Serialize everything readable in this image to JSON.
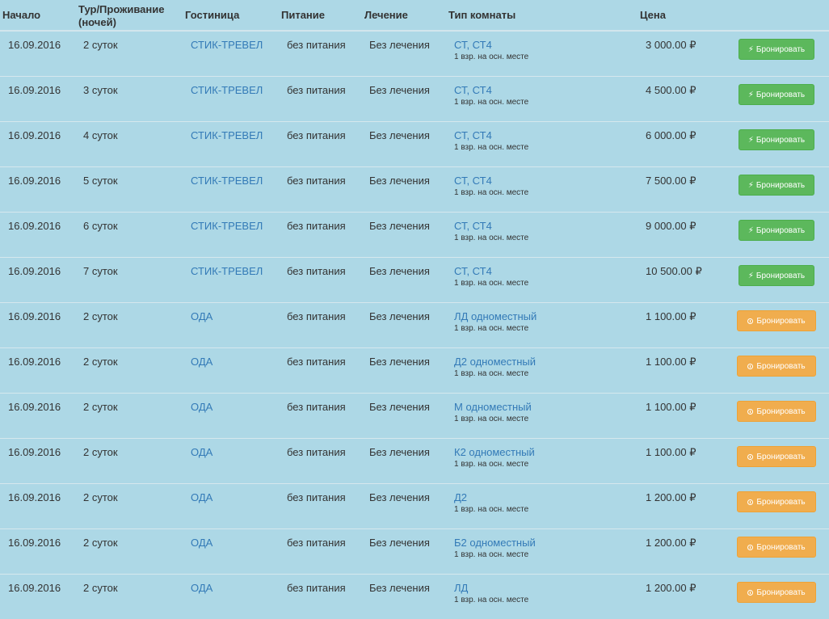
{
  "header": {
    "start": "Начало",
    "nights": "Тур/Проживание (ночей)",
    "hotel": "Гостиница",
    "meal": "Питание",
    "treatment": "Лечение",
    "room": "Тип комнаты",
    "price": "Цена"
  },
  "rows": [
    {
      "start": "16.09.2016",
      "nights": "2 суток",
      "hotel": "СТИК-ТРЕВЕЛ",
      "meal": "без питания",
      "treatment": "Без лечения",
      "room": "СТ, СТ4",
      "placement": "1 взр. на осн. месте",
      "price": "3 000.00 ₽",
      "button": "Бронировать",
      "status": "instant"
    },
    {
      "start": "16.09.2016",
      "nights": "3 суток",
      "hotel": "СТИК-ТРЕВЕЛ",
      "meal": "без питания",
      "treatment": "Без лечения",
      "room": "СТ, СТ4",
      "placement": "1 взр. на осн. месте",
      "price": "4 500.00 ₽",
      "button": "Бронировать",
      "status": "instant"
    },
    {
      "start": "16.09.2016",
      "nights": "4 суток",
      "hotel": "СТИК-ТРЕВЕЛ",
      "meal": "без питания",
      "treatment": "Без лечения",
      "room": "СТ, СТ4",
      "placement": "1 взр. на осн. месте",
      "price": "6 000.00 ₽",
      "button": "Бронировать",
      "status": "instant"
    },
    {
      "start": "16.09.2016",
      "nights": "5 суток",
      "hotel": "СТИК-ТРЕВЕЛ",
      "meal": "без питания",
      "treatment": "Без лечения",
      "room": "СТ, СТ4",
      "placement": "1 взр. на осн. месте",
      "price": "7 500.00 ₽",
      "button": "Бронировать",
      "status": "instant"
    },
    {
      "start": "16.09.2016",
      "nights": "6 суток",
      "hotel": "СТИК-ТРЕВЕЛ",
      "meal": "без питания",
      "treatment": "Без лечения",
      "room": "СТ, СТ4",
      "placement": "1 взр. на осн. месте",
      "price": "9 000.00 ₽",
      "button": "Бронировать",
      "status": "instant"
    },
    {
      "start": "16.09.2016",
      "nights": "7 суток",
      "hotel": "СТИК-ТРЕВЕЛ",
      "meal": "без питания",
      "treatment": "Без лечения",
      "room": "СТ, СТ4",
      "placement": "1 взр. на осн. месте",
      "price": "10 500.00 ₽",
      "button": "Бронировать",
      "status": "instant"
    },
    {
      "start": "16.09.2016",
      "nights": "2 суток",
      "hotel": "ОДА",
      "meal": "без питания",
      "treatment": "Без лечения",
      "room": "ЛД одноместный",
      "placement": "1 взр. на осн. месте",
      "price": "1 100.00 ₽",
      "button": "Бронировать",
      "status": "request"
    },
    {
      "start": "16.09.2016",
      "nights": "2 суток",
      "hotel": "ОДА",
      "meal": "без питания",
      "treatment": "Без лечения",
      "room": "Д2 одноместный",
      "placement": "1 взр. на осн. месте",
      "price": "1 100.00 ₽",
      "button": "Бронировать",
      "status": "request"
    },
    {
      "start": "16.09.2016",
      "nights": "2 суток",
      "hotel": "ОДА",
      "meal": "без питания",
      "treatment": "Без лечения",
      "room": "М одноместный",
      "placement": "1 взр. на осн. месте",
      "price": "1 100.00 ₽",
      "button": "Бронировать",
      "status": "request"
    },
    {
      "start": "16.09.2016",
      "nights": "2 суток",
      "hotel": "ОДА",
      "meal": "без питания",
      "treatment": "Без лечения",
      "room": "К2 одноместный",
      "placement": "1 взр. на осн. месте",
      "price": "1 100.00 ₽",
      "button": "Бронировать",
      "status": "request"
    },
    {
      "start": "16.09.2016",
      "nights": "2 суток",
      "hotel": "ОДА",
      "meal": "без питания",
      "treatment": "Без лечения",
      "room": "Д2",
      "placement": "1 взр. на осн. месте",
      "price": "1 200.00 ₽",
      "button": "Бронировать",
      "status": "request"
    },
    {
      "start": "16.09.2016",
      "nights": "2 суток",
      "hotel": "ОДА",
      "meal": "без питания",
      "treatment": "Без лечения",
      "room": "Б2 одноместный",
      "placement": "1 взр. на осн. месте",
      "price": "1 200.00 ₽",
      "button": "Бронировать",
      "status": "request"
    },
    {
      "start": "16.09.2016",
      "nights": "2 суток",
      "hotel": "ОДА",
      "meal": "без питания",
      "treatment": "Без лечения",
      "room": "ЛД",
      "placement": "1 взр. на осн. месте",
      "price": "1 200.00 ₽",
      "button": "Бронировать",
      "status": "request"
    }
  ],
  "icons": {
    "instant": "bolt-icon",
    "request": "clock-icon"
  },
  "colors": {
    "background": "#add8e6",
    "link": "#337ab7",
    "instant_button": "#5cb85c",
    "request_button": "#f0ad4e"
  }
}
